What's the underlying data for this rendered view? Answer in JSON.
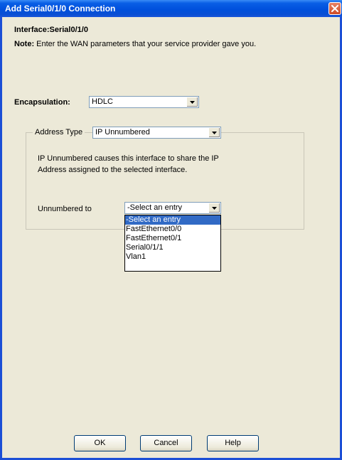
{
  "window": {
    "title": "Add Serial0/1/0 Connection"
  },
  "header": {
    "interface_label": "Interface:Serial0/1/0",
    "note_label": "Note:",
    "note_text": "Enter the WAN parameters that your service provider gave you."
  },
  "encapsulation": {
    "label": "Encapsulation:",
    "value": "HDLC"
  },
  "address_type": {
    "label": "Address Type",
    "value": "IP Unnumbered",
    "description_line1": "IP Unnumbered causes this interface to share the IP",
    "description_line2": "Address assigned to the selected interface."
  },
  "unnumbered_to": {
    "label": "Unnumbered to",
    "value": "-Select an entry",
    "options": [
      "-Select an entry",
      "FastEthernet0/0",
      "FastEthernet0/1",
      "Serial0/1/1",
      "Vlan1"
    ],
    "selected_index": 0
  },
  "buttons": {
    "ok": "OK",
    "cancel": "Cancel",
    "help": "Help"
  },
  "colors": {
    "titlebar": "#0050dc",
    "dialog_bg": "#ece9d8",
    "selection": "#316ac5",
    "close_button": "#d85a34"
  }
}
